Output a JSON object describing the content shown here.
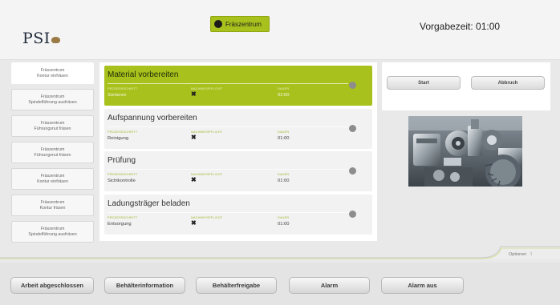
{
  "header": {
    "logo_text": "PSI",
    "station": "Fräszentrum",
    "timer_label": "Vorgabezeit: 01:00"
  },
  "sidebar": {
    "items": [
      {
        "line1": "Fräszentrum",
        "line2": "Kontur einfräsen",
        "active": true
      },
      {
        "line1": "Fräszentrum",
        "line2": "Spindelführung ausfräsen",
        "active": false
      },
      {
        "line1": "Fräszentrum",
        "line2": "Führungsnut fräsen",
        "active": false
      },
      {
        "line1": "Fräszentrum",
        "line2": "Führungsnut fräsen",
        "active": false
      },
      {
        "line1": "Fräszentrum",
        "line2": "Kontur einfräsen",
        "active": false
      },
      {
        "line1": "Fräszentrum",
        "line2": "Kontur fräsen",
        "active": false
      },
      {
        "line1": "Fräszentrum",
        "line2": "Spindelführung ausfräsen",
        "active": false
      }
    ]
  },
  "operations": [
    {
      "title": "Material vorbereiten",
      "process_label": "PROZESSSCHRITT",
      "process": "Sortieren",
      "verification_label": "NACHWEISPFLICHT",
      "duration_label": "DAUER",
      "duration": "02:00",
      "active": true
    },
    {
      "title": "Aufspannung vorbereiten",
      "process_label": "PROZESSSCHRITT",
      "process": "Reinigung",
      "verification_label": "NACHWEISPFLICHT",
      "duration_label": "DAUER",
      "duration": "01:00",
      "active": false
    },
    {
      "title": "Prüfung",
      "process_label": "PROZESSSCHRITT",
      "process": "Sichtkontrolle",
      "verification_label": "NACHWEISPFLICHT",
      "duration_label": "DAUER",
      "duration": "01:00",
      "active": false
    },
    {
      "title": "Ladungsträger beladen",
      "process_label": "PROZESSSCHRITT",
      "process": "Entsorgung",
      "verification_label": "NACHWEISPFLICHT",
      "duration_label": "DAUER",
      "duration": "01:00",
      "active": false
    }
  ],
  "actions": {
    "start": "Start",
    "cancel": "Abbruch"
  },
  "options_label": "Optionen",
  "bottom_buttons": [
    "Arbeit abgeschlossen",
    "Behälterinformation",
    "Behälterfreigabe",
    "Alarm",
    "Alarm aus"
  ],
  "colors": {
    "accent": "#a9c11d",
    "background": "#e9e9e9",
    "panel": "#ffffff",
    "card": "#f2f2f2",
    "status_dot": "#8d8d8d"
  },
  "icons": {
    "station_status": "status-dot-icon",
    "verification": "cross-icon",
    "options": "kebab-menu-icon"
  }
}
